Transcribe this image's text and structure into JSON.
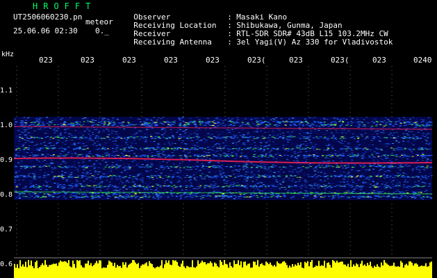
{
  "header": {
    "app_title": "HROFFT",
    "filename": "UT2506060230.pn",
    "meteor_label": "meteor",
    "datetime": "25.06.06 02:30",
    "status_value": "0._"
  },
  "info": [
    {
      "label": "Observer",
      "value": "Masaki Kano"
    },
    {
      "label": "Receiving Location",
      "value": "Shibukawa, Gunma, Japan"
    },
    {
      "label": "Receiver",
      "value": "RTL-SDR SDR# 43dB L15 103.2MHz CW"
    },
    {
      "label": "Receiving Antenna",
      "value": "3el Yagi(V) Az 330 for Vladivostok"
    }
  ],
  "axis": {
    "unit": "kHz",
    "freq_labels": [
      "1.1",
      "1.0",
      "0.9",
      "0.8",
      "0.7",
      "0.6"
    ],
    "time_labels": [
      "023",
      "023",
      "023",
      "023",
      "023",
      "023(",
      "023",
      "023(",
      "023",
      "0240"
    ]
  },
  "colors": {
    "background": "#000000",
    "header_title": "#00ff66",
    "noise_low": "#0a1aa0",
    "noise_mid": "#1e64ff",
    "signal_green": "#33dd44",
    "signal_yellow": "#ffee33",
    "signal_red": "#ff2255",
    "amplitude": "#ffff00"
  }
}
